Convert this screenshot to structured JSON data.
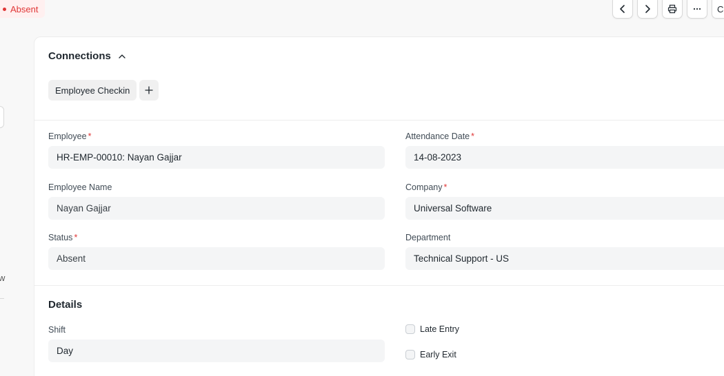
{
  "doc_status": {
    "label": "Absent",
    "color": "#e03636"
  },
  "toolbar": {
    "prev_icon": "chevron-left-icon",
    "next_icon": "chevron-right-icon",
    "print_icon": "printer-icon",
    "more_icon": "ellipsis-icon",
    "partial_label": "C"
  },
  "sidebar": {
    "partial_text": "w"
  },
  "connections": {
    "title": "Connections",
    "toggle_icon": "chevron-up-icon",
    "items": [
      {
        "label": "Employee Checkin"
      }
    ],
    "add_icon": "plus-icon"
  },
  "form": {
    "employee": {
      "label": "Employee",
      "required": "*",
      "value": "HR-EMP-00010: Nayan Gajjar"
    },
    "attendance_date": {
      "label": "Attendance Date",
      "required": "*",
      "value": "14-08-2023"
    },
    "employee_name": {
      "label": "Employee Name",
      "value": "Nayan Gajjar"
    },
    "company": {
      "label": "Company",
      "required": "*",
      "value": "Universal Software"
    },
    "status": {
      "label": "Status",
      "required": "*",
      "value": "Absent"
    },
    "department": {
      "label": "Department",
      "value": "Technical Support - US"
    }
  },
  "details": {
    "title": "Details",
    "shift": {
      "label": "Shift",
      "value": "Day"
    },
    "late_entry": {
      "label": "Late Entry",
      "checked": false
    },
    "early_exit": {
      "label": "Early Exit",
      "checked": false
    }
  }
}
